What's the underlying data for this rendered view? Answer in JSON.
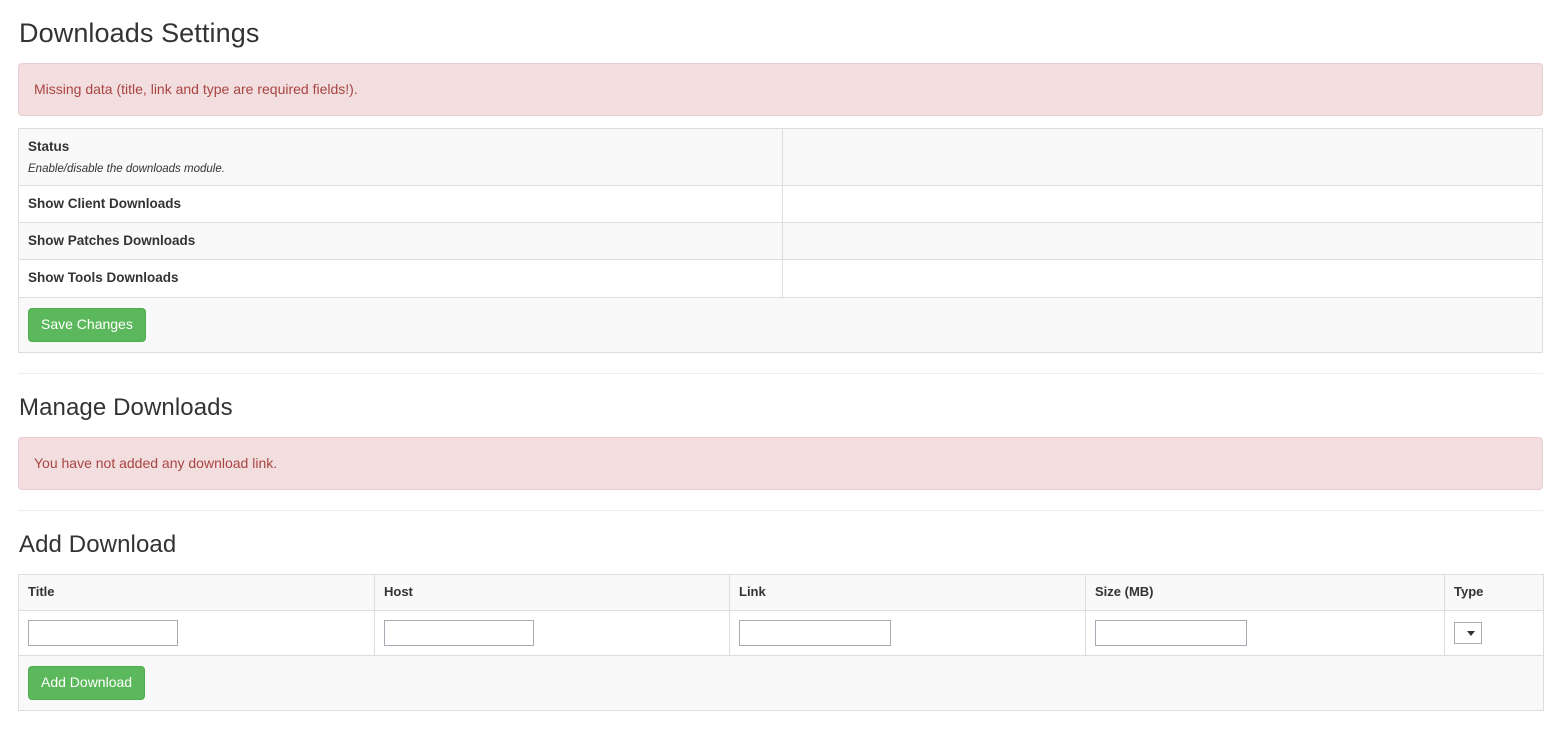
{
  "page": {
    "title": "Downloads Settings",
    "alert_missing_data": "Missing data (title, link and type are required fields!)."
  },
  "settings": {
    "rows": [
      {
        "name": "Status",
        "desc": "Enable/disable the downloads module.",
        "value": ""
      },
      {
        "name": "Show Client Downloads",
        "desc": "",
        "value": ""
      },
      {
        "name": "Show Patches Downloads",
        "desc": "",
        "value": ""
      },
      {
        "name": "Show Tools Downloads",
        "desc": "",
        "value": ""
      }
    ],
    "save_label": "Save Changes"
  },
  "manage": {
    "title": "Manage Downloads",
    "empty_message": "You have not added any download link."
  },
  "add": {
    "title": "Add Download",
    "columns": [
      "Title",
      "Host",
      "Link",
      "Size (MB)",
      "Type"
    ],
    "fields": {
      "title_value": "",
      "host_value": "",
      "link_value": "",
      "size_value": "",
      "type_value": ""
    },
    "type_options": [
      ""
    ],
    "submit_label": "Add Download"
  },
  "colors": {
    "accent_green": "#5cb85c",
    "alert_bg": "#f2dede",
    "alert_text": "#a94442",
    "alert_border": "#ebccd1",
    "table_border": "#dddddd",
    "stripe_bg": "#f9f9f9",
    "heading": "#333333"
  }
}
